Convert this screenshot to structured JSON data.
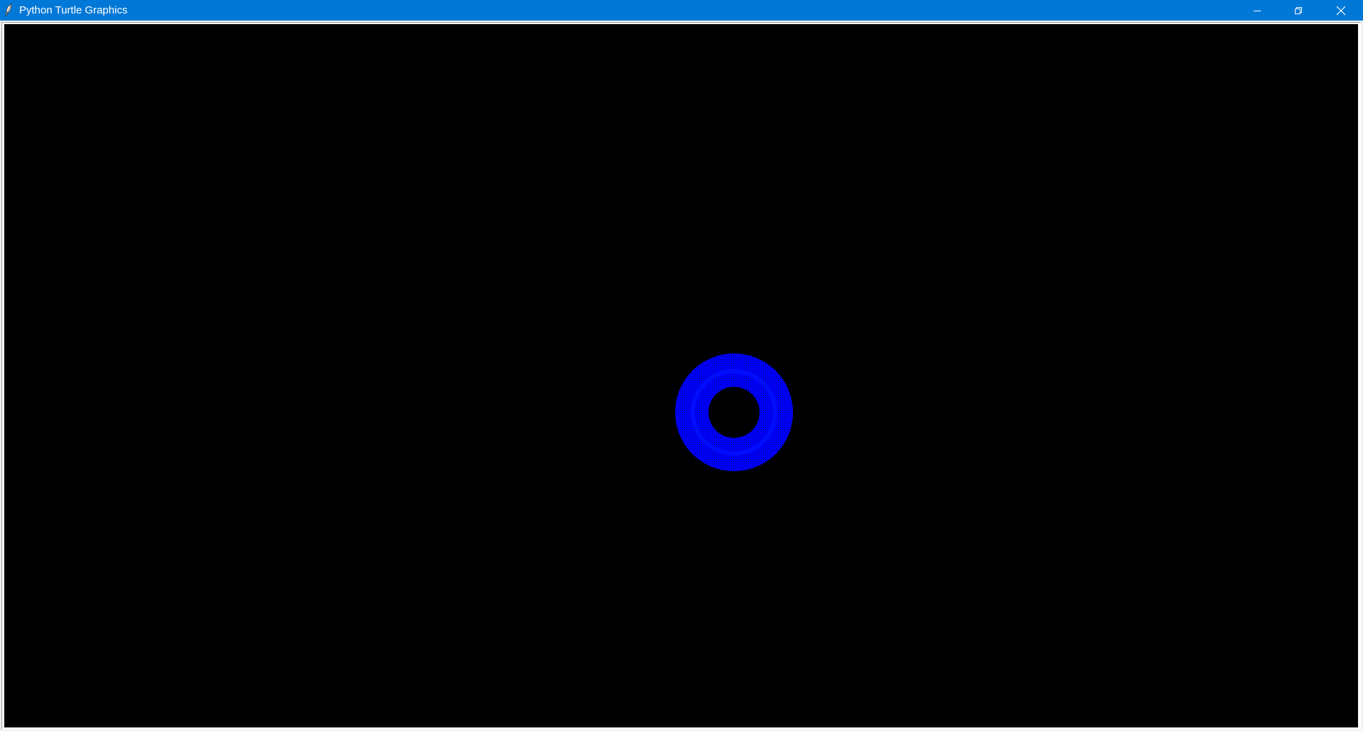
{
  "window": {
    "title": "Python Turtle Graphics",
    "titlebar_color": "#0078d7",
    "icons": {
      "app": "feather-icon",
      "minimize": "minimize-icon",
      "restore": "restore-icon",
      "close": "close-icon"
    }
  },
  "canvas": {
    "background": "#000000",
    "drawing": {
      "shape": "ring",
      "color": "#0000ff",
      "description_type": "dotted-annulus"
    }
  }
}
